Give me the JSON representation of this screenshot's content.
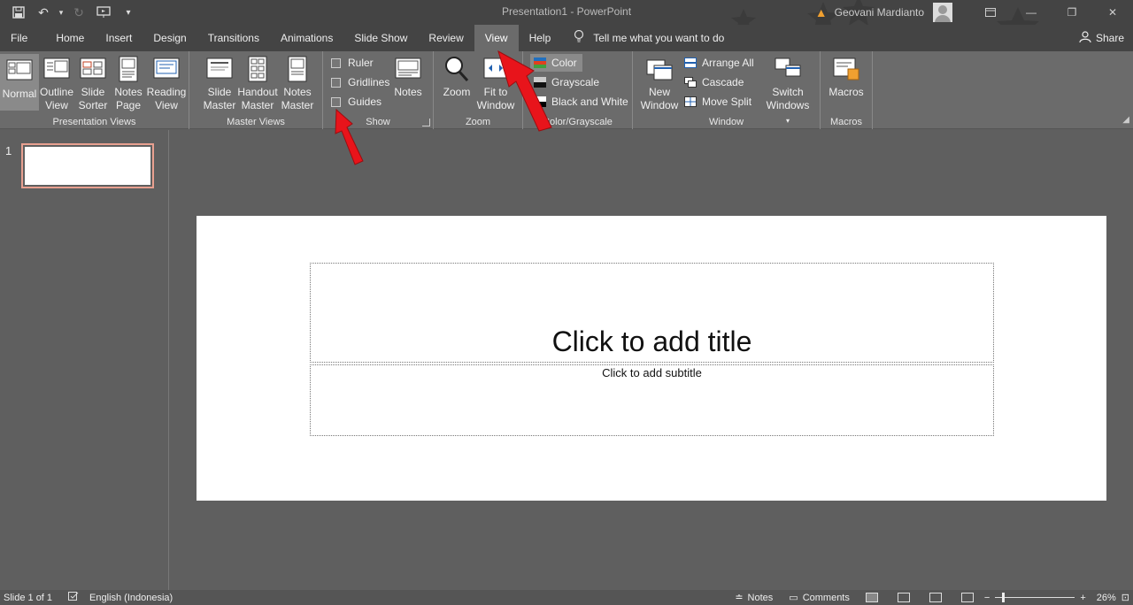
{
  "window": {
    "title": "Presentation1  -  PowerPoint",
    "user": "Geovani Mardianto"
  },
  "tabs": [
    {
      "label": "File"
    },
    {
      "label": "Home"
    },
    {
      "label": "Insert"
    },
    {
      "label": "Design"
    },
    {
      "label": "Transitions"
    },
    {
      "label": "Animations"
    },
    {
      "label": "Slide Show"
    },
    {
      "label": "Review"
    },
    {
      "label": "View"
    },
    {
      "label": "Help"
    }
  ],
  "tell_me": "Tell me what you want to do",
  "share": "Share",
  "ribbon": {
    "presentation_views": {
      "label": "Presentation Views",
      "normal": "Normal",
      "outline_1": "Outline",
      "outline_2": "View",
      "sorter_1": "Slide",
      "sorter_2": "Sorter",
      "notes_1": "Notes",
      "notes_2": "Page",
      "reading_1": "Reading",
      "reading_2": "View"
    },
    "master_views": {
      "label": "Master Views",
      "slide_1": "Slide",
      "slide_2": "Master",
      "handout_1": "Handout",
      "handout_2": "Master",
      "notes_1": "Notes",
      "notes_2": "Master"
    },
    "show": {
      "label": "Show",
      "ruler": "Ruler",
      "gridlines": "Gridlines",
      "guides": "Guides",
      "notes": "Notes"
    },
    "zoom": {
      "label": "Zoom",
      "zoom": "Zoom",
      "fit_1": "Fit to",
      "fit_2": "Window"
    },
    "color": {
      "label": "Color/Grayscale",
      "color": "Color",
      "grayscale": "Grayscale",
      "bw": "Black and White"
    },
    "window": {
      "label": "Window",
      "new_1": "New",
      "new_2": "Window",
      "arrange": "Arrange All",
      "cascade": "Cascade",
      "move_split": "Move Split",
      "switch_1": "Switch",
      "switch_2": "Windows"
    },
    "macros": {
      "label": "Macros",
      "macros": "Macros"
    }
  },
  "thumbnails": [
    {
      "number": "1"
    }
  ],
  "slide": {
    "title_placeholder": "Click to add title",
    "subtitle_placeholder": "Click to add subtitle"
  },
  "status": {
    "slide": "Slide 1 of 1",
    "language": "English (Indonesia)",
    "notes": "Notes",
    "comments": "Comments",
    "zoom": "26%"
  },
  "colors": {
    "annotation_arrow": "#e8141b",
    "ribbon_bg": "#6b6b6b",
    "title_bg": "#444444"
  }
}
